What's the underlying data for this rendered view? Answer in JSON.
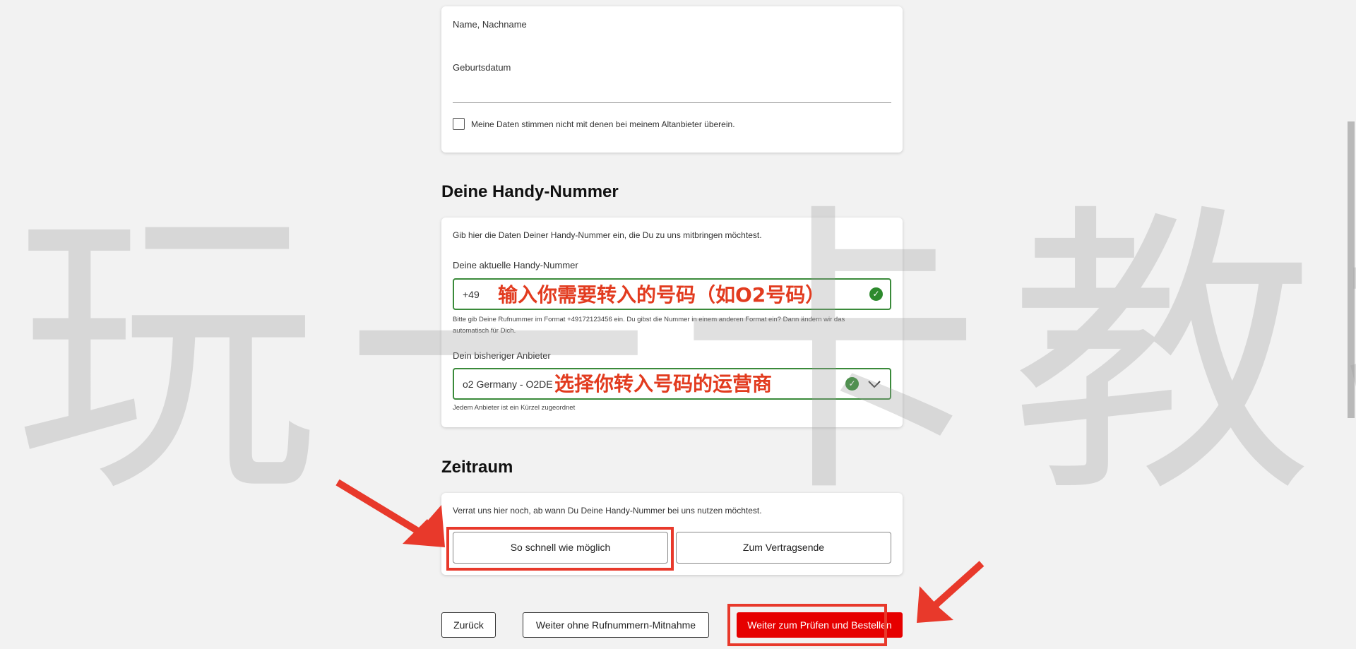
{
  "personal_card": {
    "name_label": "Name, Nachname",
    "birth_label": "Geburtsdatum",
    "mismatch_checkbox_label": "Meine Daten stimmen nicht mit denen bei meinem Altanbieter überein."
  },
  "number_section": {
    "heading": "Deine Handy-Nummer",
    "intro": "Gib hier die Daten Deiner Handy-Nummer ein, die Du zu uns mitbringen möchtest.",
    "current_number_label": "Deine aktuelle Handy-Nummer",
    "prefix": "+49",
    "number_hint": "Bitte gib Deine Rufnummer im Format +49172123456 ein. Du gibst die Nummer in einem anderen Format ein? Dann ändern wir das automatisch für Dich.",
    "provider_label": "Dein bisheriger Anbieter",
    "provider_value": "o2 Germany - O2DE",
    "provider_hint": "Jedem Anbieter ist ein Kürzel zugeordnet"
  },
  "period_section": {
    "heading": "Zeitraum",
    "intro": "Verrat uns hier noch, ab wann Du Deine Handy-Nummer bei uns nutzen möchtest.",
    "option_asap": "So schnell wie möglich",
    "option_contract_end": "Zum Vertragsende"
  },
  "footer_buttons": {
    "back": "Zurück",
    "continue_without": "Weiter ohne Rufnummern-Mitnahme",
    "continue_check": "Weiter zum Prüfen und Bestellen"
  },
  "annotations": {
    "number_note": "输入你需要转入的号码（如O2号码）",
    "provider_note": "选择你转入号码的运营商"
  },
  "watermark": "玩一卡教授",
  "colors": {
    "brand_red": "#e60000",
    "annotation_red": "#e8392b",
    "valid_green": "#2d8a2d"
  }
}
